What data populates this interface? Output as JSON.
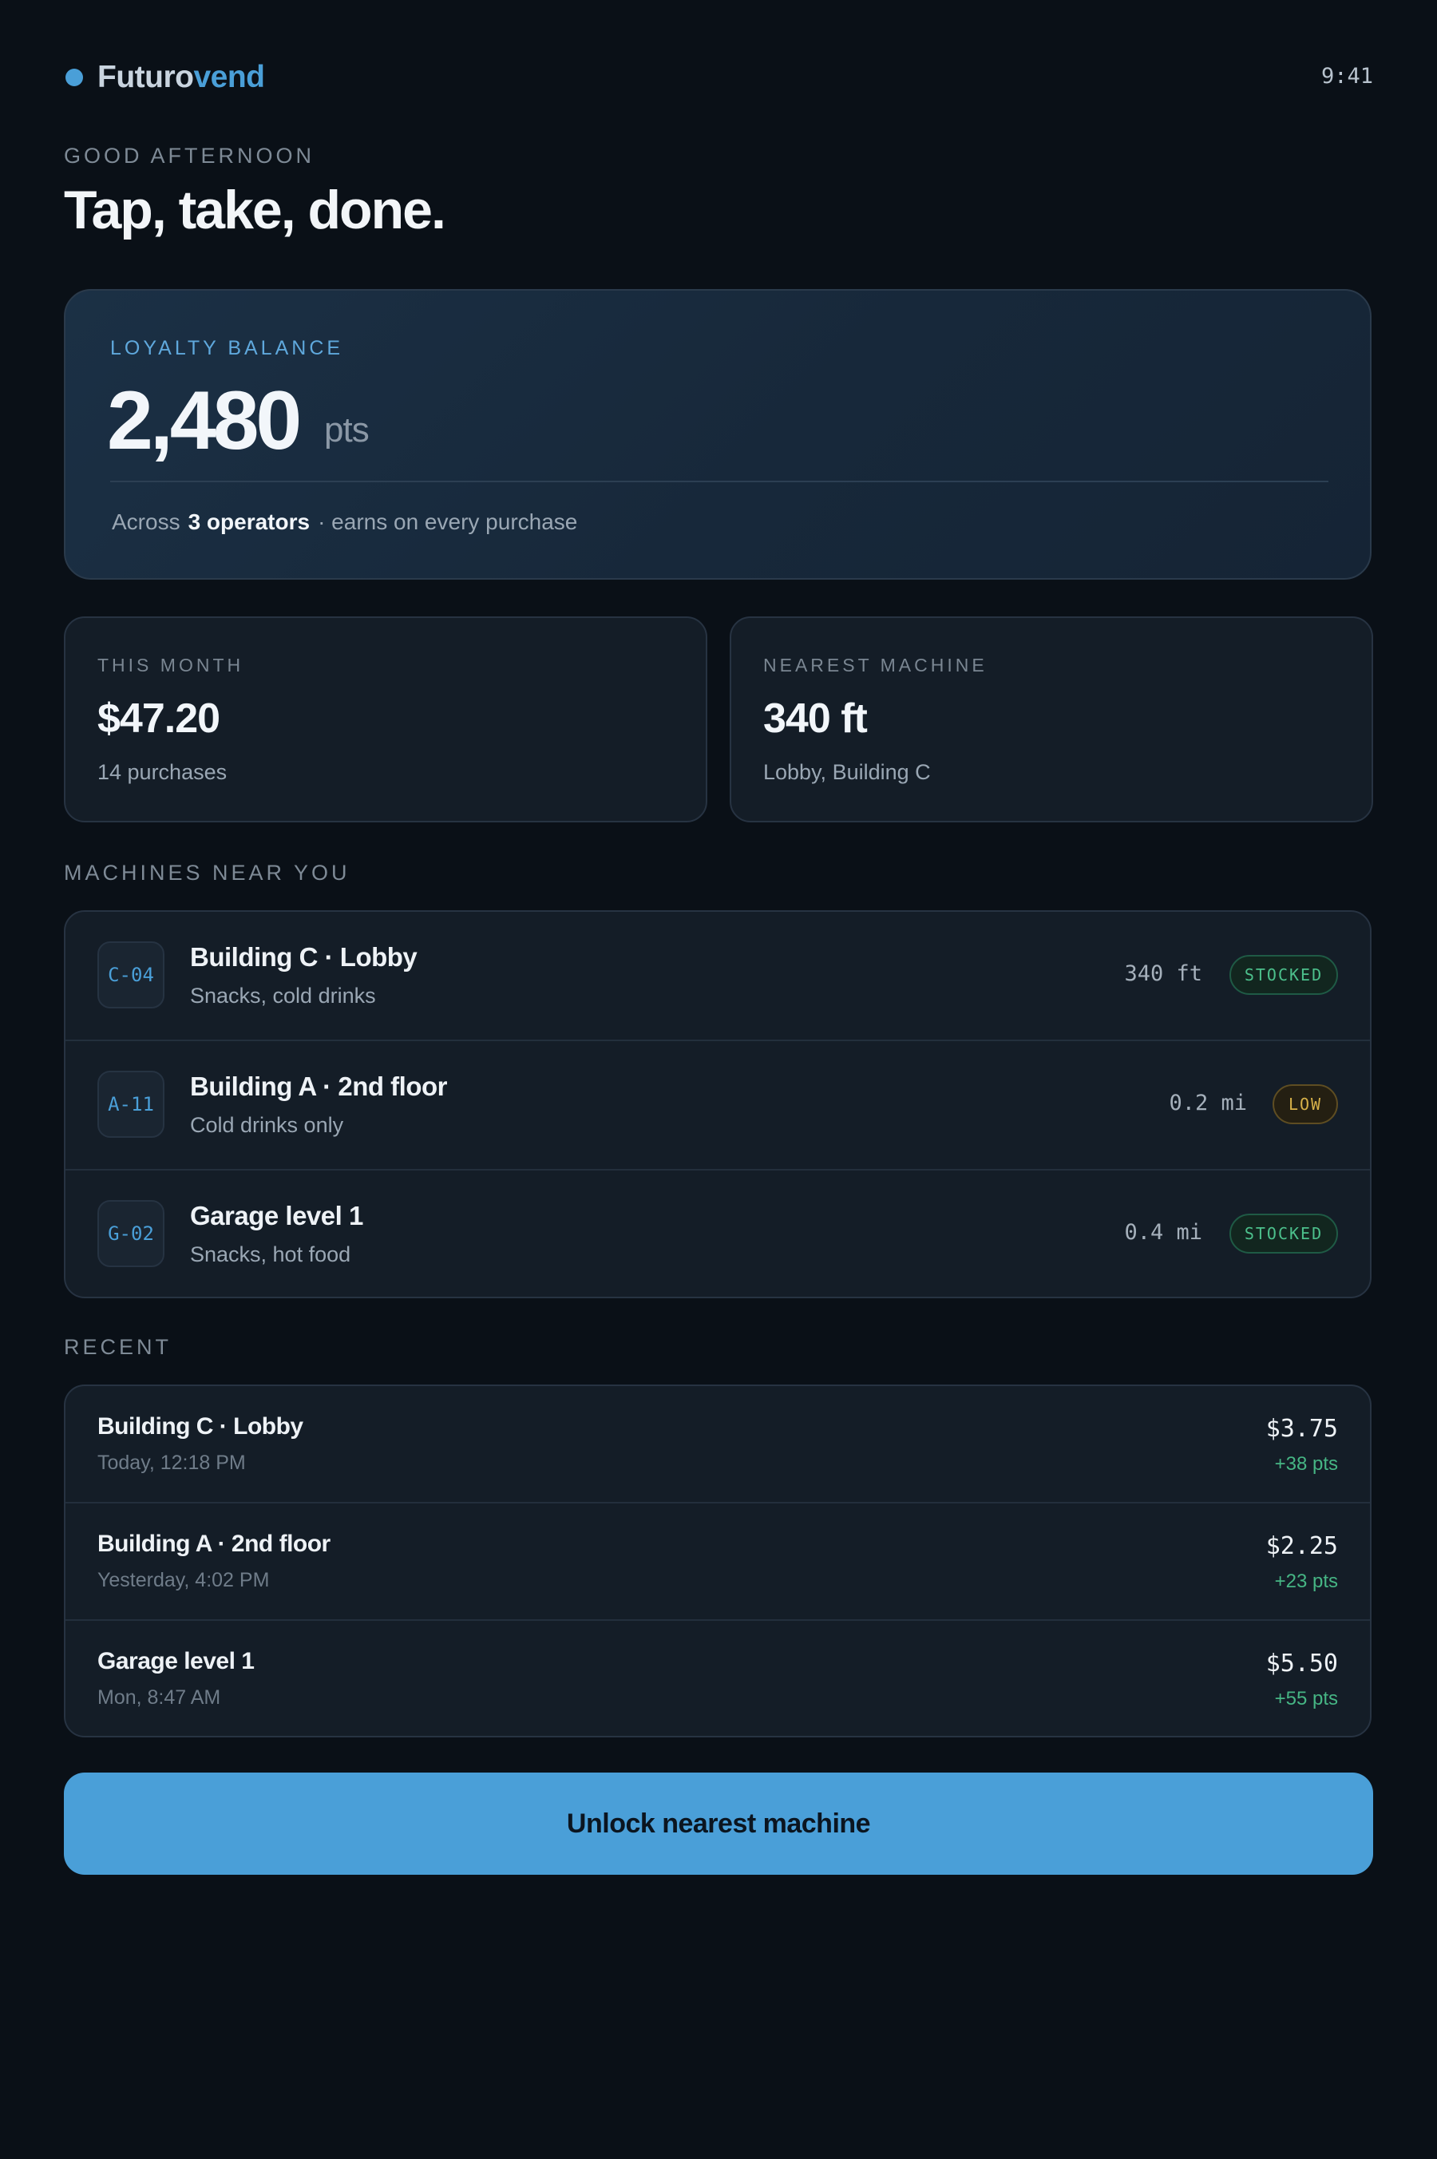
{
  "header": {
    "brand_part1": "Futuro",
    "brand_part2": "vend",
    "time": "9:41"
  },
  "greeting": "GOOD AFTERNOON",
  "headline": "Tap, take, done.",
  "loyalty": {
    "label": "LOYALTY BALANCE",
    "value": "2,480",
    "unit": "pts",
    "foot_prefix": "Across",
    "foot_strong": "3 operators",
    "foot_suffix": "· earns on every purchase"
  },
  "stats": {
    "month": {
      "label": "THIS MONTH",
      "value": "$47.20",
      "sub": "14 purchases"
    },
    "nearest": {
      "label": "NEAREST MACHINE",
      "value": "340 ft",
      "sub": "Lobby, Building C"
    }
  },
  "machines": {
    "title": "MACHINES NEAR YOU",
    "items": [
      {
        "code": "C-04",
        "name": "Building C · Lobby",
        "desc": "Snacks, cold drinks",
        "distance": "340 ft",
        "status": "STOCKED"
      },
      {
        "code": "A-11",
        "name": "Building A · 2nd floor",
        "desc": "Cold drinks only",
        "distance": "0.2 mi",
        "status": "LOW"
      },
      {
        "code": "G-02",
        "name": "Garage level 1",
        "desc": "Snacks, hot food",
        "distance": "0.4 mi",
        "status": "STOCKED"
      }
    ]
  },
  "recent": {
    "title": "RECENT",
    "items": [
      {
        "name": "Building C · Lobby",
        "time": "Today, 12:18 PM",
        "amount": "$3.75",
        "points": "+38 pts"
      },
      {
        "name": "Building A · 2nd floor",
        "time": "Yesterday, 4:02 PM",
        "amount": "$2.25",
        "points": "+23 pts"
      },
      {
        "name": "Garage level 1",
        "time": "Mon, 8:47 AM",
        "amount": "$5.50",
        "points": "+55 pts"
      }
    ]
  },
  "cta": {
    "label": "Unlock nearest machine"
  },
  "colors": {
    "background": "#0a1017",
    "accent": "#4a9fd8",
    "stocked": "#4cc08c",
    "low": "#d7b149",
    "points": "#46b584"
  }
}
